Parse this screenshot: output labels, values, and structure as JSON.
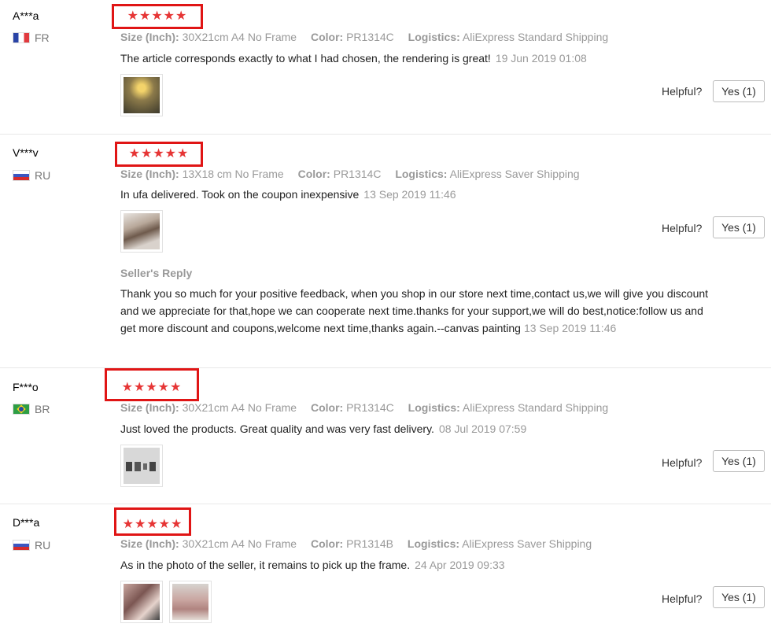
{
  "helpful_label": "Helpful?",
  "meta_keys": {
    "size": "Size (Inch):",
    "color": "Color:",
    "logistics": "Logistics:"
  },
  "reviews": [
    {
      "user": "A***a",
      "country": "FR",
      "stars": "★★★★★",
      "size": "30X21cm A4 No Frame",
      "color": "PR1314C",
      "logistics": "AliExpress Standard Shipping",
      "text": "The article corresponds exactly to what I had chosen, the rendering is great!",
      "date": "19 Jun 2019 01:08",
      "helpful_button": "Yes (1)"
    },
    {
      "user": "V***v",
      "country": "RU",
      "stars": "★★★★★",
      "size": "13X18 cm No Frame",
      "color": "PR1314C",
      "logistics": "AliExpress Saver Shipping",
      "text": "In ufa delivered. Took on the coupon inexpensive",
      "date": "13 Sep 2019 11:46",
      "helpful_button": "Yes (1)",
      "seller_reply": {
        "title": "Seller's Reply",
        "text": "Thank you so much for your positive feedback, when you shop in our store next time,contact us,we will give you discount and we appreciate for that,hope we can cooperate next time.thanks for your support,we will do best,notice:follow us and get more discount and coupons,welcome next time,thanks again.--canvas painting",
        "date": "13 Sep 2019 11:46"
      }
    },
    {
      "user": "F***o",
      "country": "BR",
      "stars": "★★★★★",
      "size": "30X21cm A4 No Frame",
      "color": "PR1314C",
      "logistics": "AliExpress Standard Shipping",
      "text": "Just loved the products. Great quality and was very fast delivery.",
      "date": "08 Jul 2019 07:59",
      "helpful_button": "Yes (1)"
    },
    {
      "user": "D***a",
      "country": "RU",
      "stars": "★★★★★",
      "size": "30X21cm A4 No Frame",
      "color": "PR1314B",
      "logistics": "AliExpress Saver Shipping",
      "text": "As in the photo of the seller, it remains to pick up the frame.",
      "date": "24 Apr 2019 09:33",
      "helpful_button": "Yes (1)"
    }
  ]
}
